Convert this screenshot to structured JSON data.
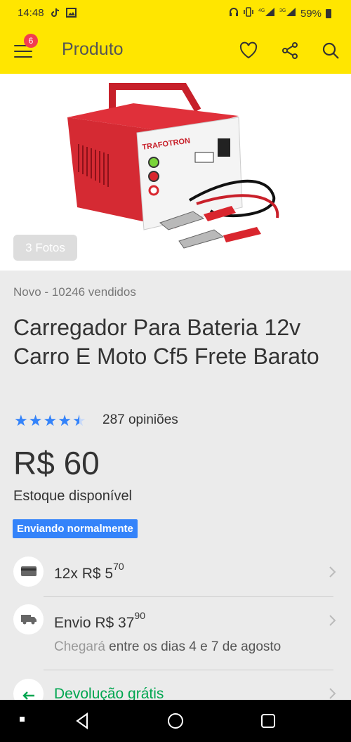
{
  "status_bar": {
    "time": "14:48",
    "battery": "59%",
    "icons_left": [
      "tiktok-icon",
      "gallery-icon"
    ],
    "icons_right": [
      "headphones-icon",
      "vibrate-icon",
      "4g-signal-icon",
      "3g-signal-icon",
      "battery-icon"
    ]
  },
  "header": {
    "title": "Produto",
    "cart_badge": "6"
  },
  "hero": {
    "photos_label": "3 Fotos",
    "image_brand_text": "TRAFOTRON"
  },
  "product": {
    "condition": "Novo - 10246 vendidos",
    "title": "Carregador Para Bateria 12v Carro E Moto Cf5 Frete Barato",
    "rating": 4.5,
    "opinions": "287 opiniões",
    "price": "R$ 60",
    "stock": "Estoque disponível",
    "shipping_badge": "Enviando normalmente"
  },
  "installments": {
    "count": "12x R$ 5",
    "cents": "70"
  },
  "shipping": {
    "label": "Envio R$ 37",
    "cents": "90",
    "eta_prefix": "Chegará",
    "eta_rest": " entre os dias 4 e 7 de agosto"
  },
  "returns": {
    "label": "Devolução grátis"
  },
  "colors": {
    "brand_yellow": "#ffe600",
    "accent_blue": "#3483fa",
    "badge_red": "#f23d4f",
    "success_green": "#00a650"
  }
}
